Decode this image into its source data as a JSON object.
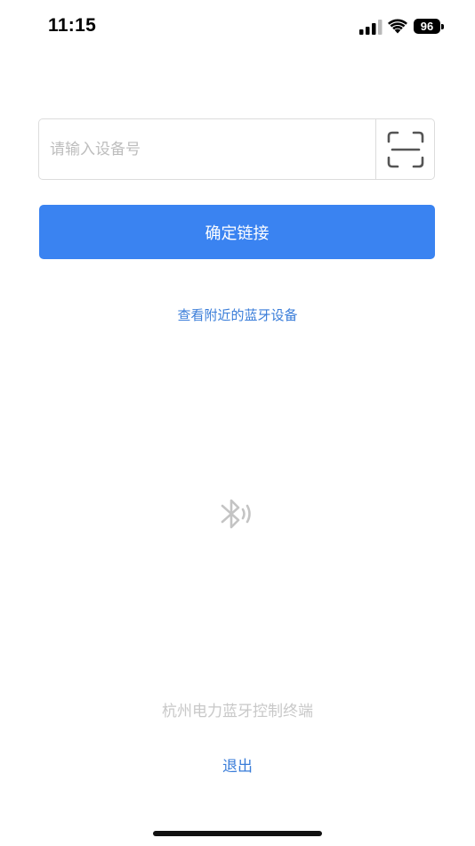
{
  "status_bar": {
    "time": "11:15",
    "battery": "96",
    "signal_icon": "cellular-signal-icon",
    "wifi_icon": "wifi-icon"
  },
  "device_input": {
    "placeholder": "请输入设备号",
    "value": ""
  },
  "scan_icon": "scan-qr-icon",
  "confirm_label": "确定链接",
  "nearby_link_label": "查看附近的蓝牙设备",
  "bluetooth_icon": "bluetooth-icon",
  "footer_caption": "杭州电力蓝牙控制终端",
  "logout_label": "退出",
  "colors": {
    "accent": "#3a83f1",
    "link": "#3a7dd9",
    "muted": "#c8c8c8"
  }
}
